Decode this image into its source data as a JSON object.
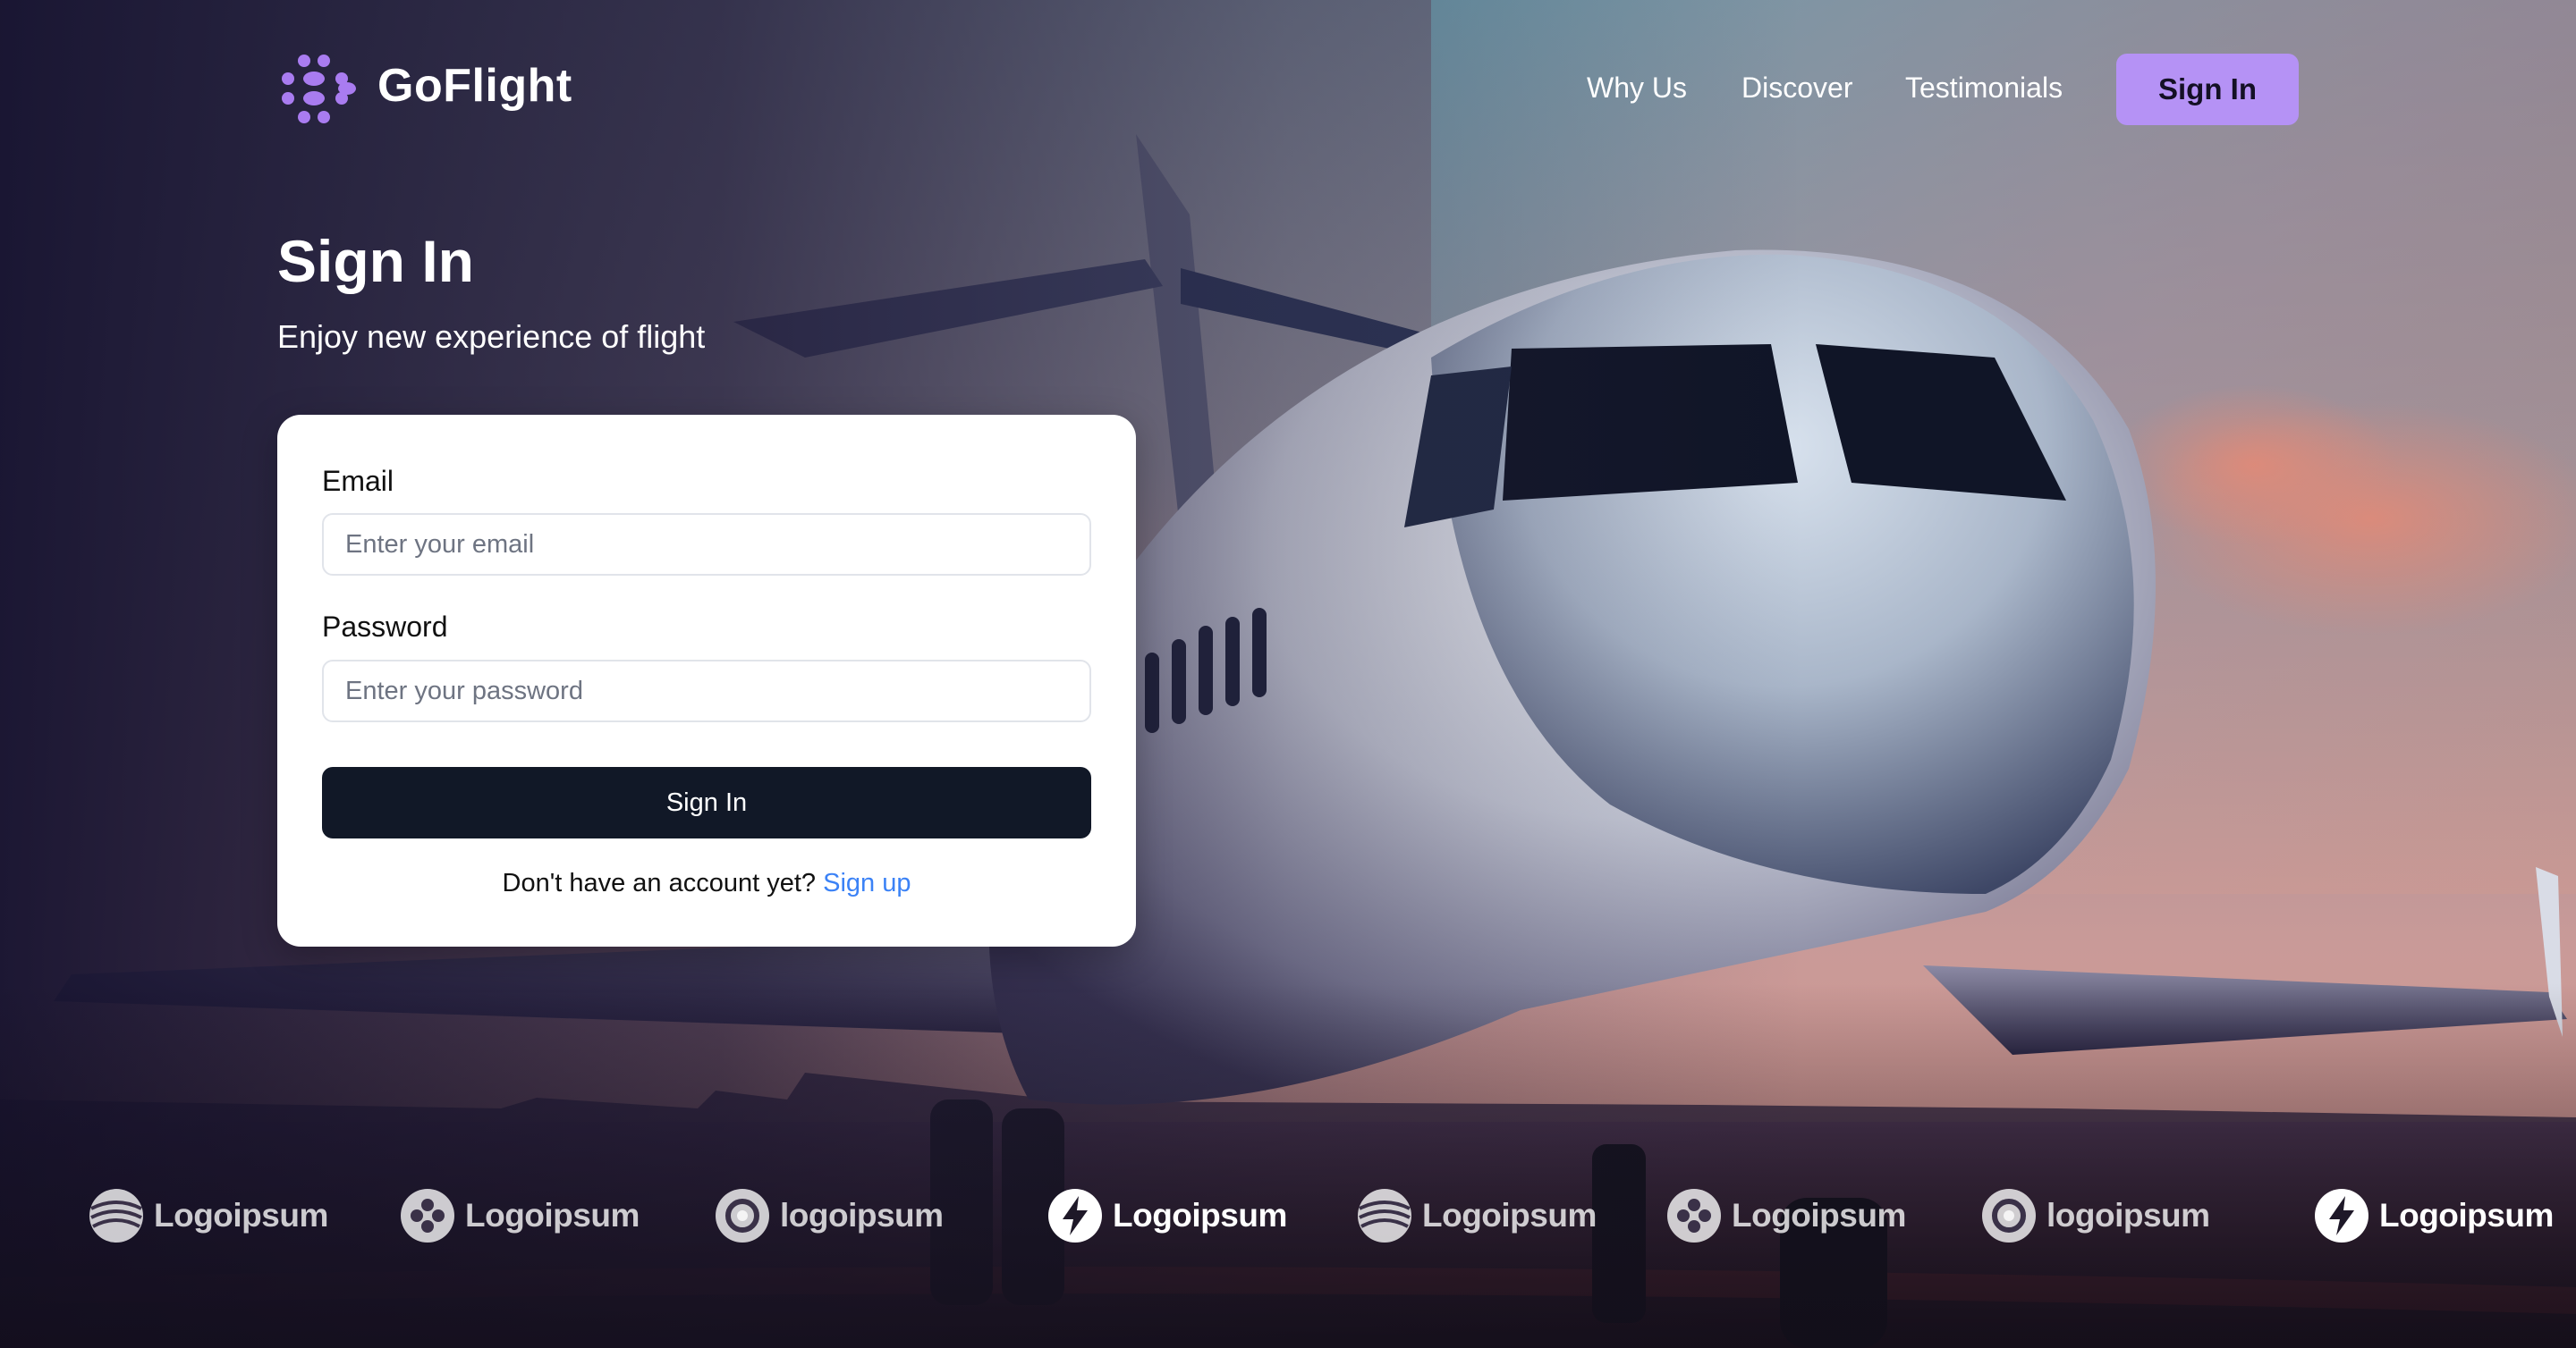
{
  "header": {
    "brand": "GoFlight",
    "nav": [
      {
        "label": "Why Us"
      },
      {
        "label": "Discover"
      },
      {
        "label": "Testimonials"
      }
    ],
    "signin_label": "Sign In"
  },
  "hero": {
    "title": "Sign In",
    "subtitle": "Enjoy new experience of flight"
  },
  "form": {
    "email_label": "Email",
    "email_placeholder": "Enter your email",
    "email_value": "",
    "password_label": "Password",
    "password_placeholder": "Enter your password",
    "password_value": "",
    "submit_label": "Sign In",
    "signup_prompt": "Don't have an account yet?",
    "signup_link": "Sign up"
  },
  "partners": [
    {
      "label": "Logoipsum",
      "icon": "globe-stripes-icon"
    },
    {
      "label": "Logoipsum",
      "icon": "dots-circle-icon"
    },
    {
      "label": "logoipsum",
      "icon": "ring-icon"
    },
    {
      "label": "Logoipsum",
      "icon": "bolt-icon"
    },
    {
      "label": "Logoipsum",
      "icon": "globe-stripes-icon"
    },
    {
      "label": "Logoipsum",
      "icon": "dots-circle-icon"
    },
    {
      "label": "logoipsum",
      "icon": "ring-icon"
    },
    {
      "label": "Logoipsum",
      "icon": "bolt-icon"
    }
  ],
  "colors": {
    "accent": "#b592f5",
    "button_dark": "#111827",
    "link": "#3b82f6",
    "brand_dots": "#a97cf0"
  }
}
